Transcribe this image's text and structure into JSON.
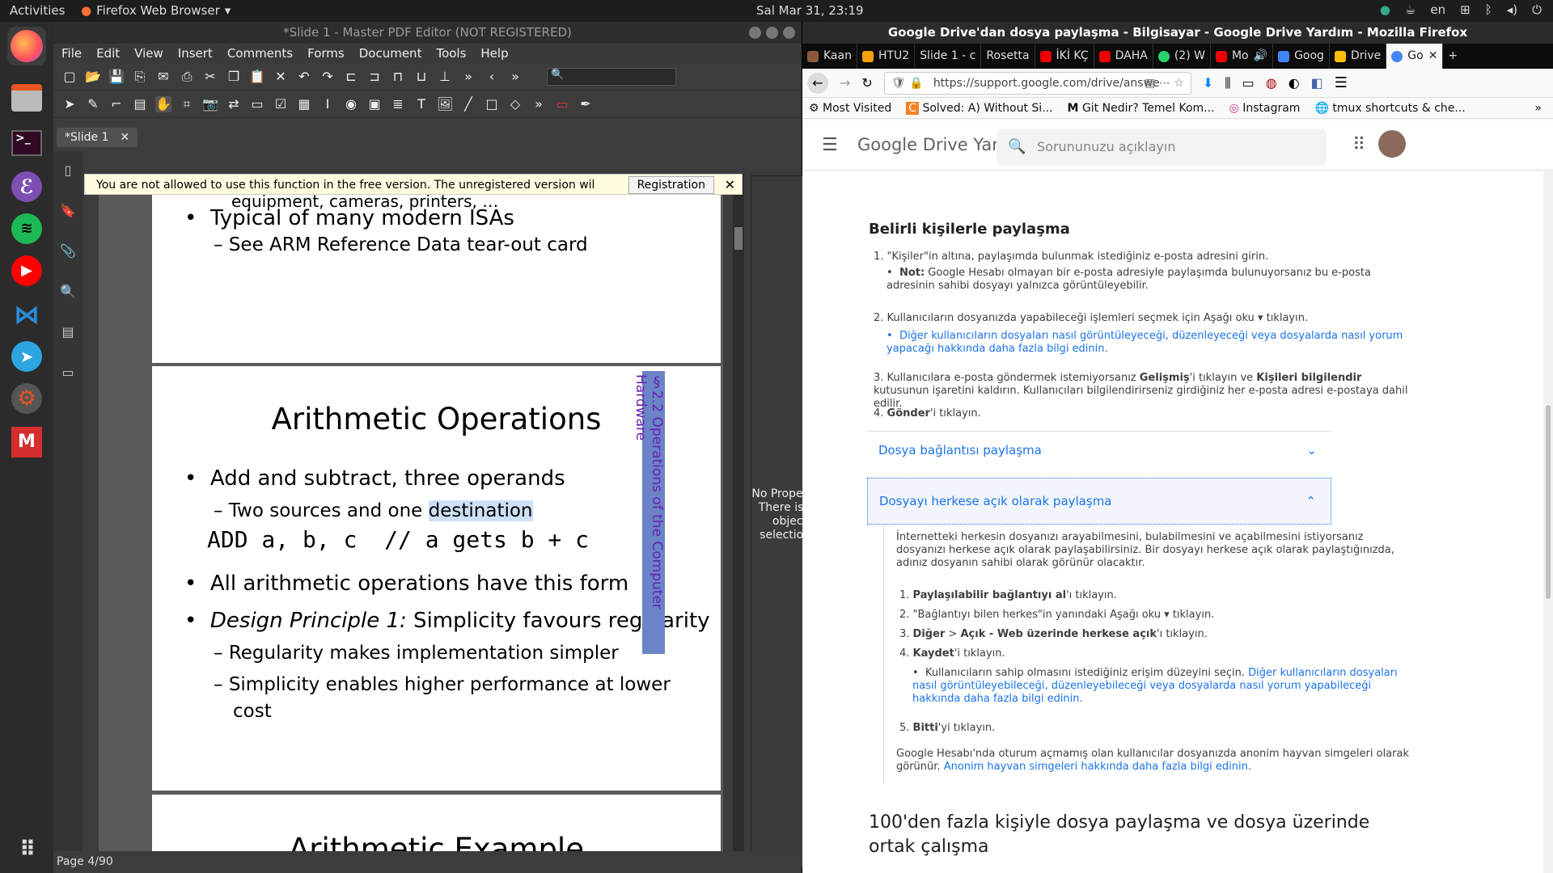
{
  "topbar": {
    "activities": "Activities",
    "app_name": "Firefox Web Browser",
    "clock": "Sal Mar 31, 23:19",
    "lang": "en"
  },
  "dock": {
    "items": [
      "firefox",
      "files",
      "terminal",
      "emacs",
      "spotify",
      "youtube",
      "vscode",
      "telegram",
      "settings",
      "pdf-editor",
      "app-grid"
    ]
  },
  "pdf": {
    "title": "*Slide 1 - Master PDF Editor (NOT REGISTERED)",
    "menu": [
      "File",
      "Edit",
      "View",
      "Insert",
      "Comments",
      "Forms",
      "Document",
      "Tools",
      "Help"
    ],
    "tab": "*Slide 1",
    "notice": "You are not allowed to use this function in the free version.  The unregistered version wil",
    "registration": "Registration",
    "page1": {
      "cut_line": "equipment, cameras, printers, …",
      "bullet": "Typical of many modern ISAs",
      "sub": "See ARM Reference Data tear-out card"
    },
    "page2": {
      "title": "Arithmetic Operations",
      "b1": "Add and subtract, three operands",
      "s1a": "Two sources and one ",
      "s1b": "destination",
      "code": "ADD a, b, c  // a gets b + c",
      "b2": "All arithmetic operations have this form",
      "b3i": "Design Principle 1:",
      "b3": " Simplicity favours regularity",
      "s3": "Regularity makes implementation simpler",
      "s4": "Simplicity enables higher performance at lower",
      "s4b": "cost",
      "tag": "§2.2 Operations of the Computer Hardware"
    },
    "page3": {
      "title": "Arithmetic Example"
    },
    "props": "No Properties There is no object selections.",
    "status": "Page 4/90"
  },
  "ff": {
    "title": "Google Drive'dan dosya paylaşma - Bilgisayar - Google Drive Yardım - Mozilla Firefox",
    "tabs": [
      {
        "label": "Kaan",
        "color": "#8b5a3c"
      },
      {
        "label": "HTU2",
        "color": "#f0a000"
      },
      {
        "label": "Slide 1 - c",
        "color": "#555"
      },
      {
        "label": "Rosetta",
        "color": "#555"
      },
      {
        "label": "İKİ KÇ",
        "color": "#e00"
      },
      {
        "label": "DAHA",
        "color": "#e00"
      },
      {
        "label": "(2) W",
        "color": "#25d366"
      },
      {
        "label": "Mo",
        "color": "#e00"
      },
      {
        "label": "Goog",
        "color": "#4285f4"
      },
      {
        "label": "Drive",
        "color": "#fbbc04"
      },
      {
        "label": "Go",
        "color": "#4285f4"
      }
    ],
    "url": "https://support.google.com/drive/answe",
    "bookmarks": [
      "Most Visited",
      "Solved: A) Without Si...",
      "Git Nedir? Temel Kom...",
      "Instagram",
      "tmux shortcuts & che..."
    ],
    "brand": "Google Drive Yardım",
    "search_placeholder": "Sorununuzu açıklayın",
    "sec1_title": "Belirli kişilerle paylaşma",
    "s1_1": "1. \"Kişiler\"in altına, paylaşımda bulunmak istediğiniz e-posta adresini girin.",
    "s1_note_b": "Not:",
    "s1_note": " Google Hesabı olmayan bir e-posta adresiyle paylaşımda bulunuyorsanız bu e-posta adresinin sahibi dosyayı yalnızca görüntüleyebilir.",
    "s1_2": "2. Kullanıcıların dosyanızda yapabileceği işlemleri seçmek için Aşağı oku ▾ tıklayın.",
    "s1_2link": "Diğer kullanıcıların dosyaları nasıl görüntüleyeceği, düzenleyeceği veya dosyalarda nasıl yorum yapacağı hakkında daha fazla bilgi edinin.",
    "s1_3a": "3. Kullanıcılara e-posta göndermek istemiyorsanız ",
    "s1_3b": "Gelişmiş",
    "s1_3c": "'i tıklayın ve ",
    "s1_3d": "Kişileri bilgilendir",
    "s1_3e": " kutusunun işaretini kaldırın. Kullanıcıları bilgilendirirseniz girdiğiniz her e-posta adresi e-postaya dahil edilir.",
    "s1_4b": "Gönder",
    "s1_4": "'i tıklayın.",
    "acc1": "Dosya bağlantısı paylaşma",
    "acc2": "Dosyayı herkese açık olarak paylaşma",
    "acc2_intro": "İnternetteki herkesin dosyanızı arayabilmesini, bulabilmesini ve açabilmesini istiyorsanız dosyanızı herkese açık olarak paylaşabilirsiniz. Bir dosyayı herkese açık olarak paylaştığınızda, adınız dosyanın sahibi olarak görünür olacaktır.",
    "a1": "Paylaşılabilir bağlantıyı al",
    "a1s": "'ı tıklayın.",
    "a2": "2. \"Bağlantıyı bilen herkes\"in yanındaki Aşağı oku ▾ tıklayın.",
    "a3a": "Diğer",
    "a3b": "Açık - Web üzerinde herkese açık",
    "a3c": "'ı tıklayın.",
    "a4": "Kaydet",
    "a4s": "'i tıklayın.",
    "a4sub": "Kullanıcıların sahip olmasını istediğiniz erişim düzeyini seçin. ",
    "a4link": "Diğer kullanıcıların dosyaları nasıl görüntüleyebileceği, düzenleyebileceği veya dosyalarda nasıl yorum yapabileceği hakkında daha fazla bilgi edinin.",
    "a5": "Bitti",
    "a5s": "'yi tıklayın.",
    "anon": "Google Hesabı'nda oturum açmamış olan kullanıcılar dosyanızda anonim hayvan simgeleri olarak görünür. ",
    "anonlink": "Anonim hayvan simgeleri hakkında daha fazla bilgi edinin.",
    "sec2_title": "100'den fazla kişiyle dosya paylaşma ve dosya üzerinde ortak çalışma"
  }
}
